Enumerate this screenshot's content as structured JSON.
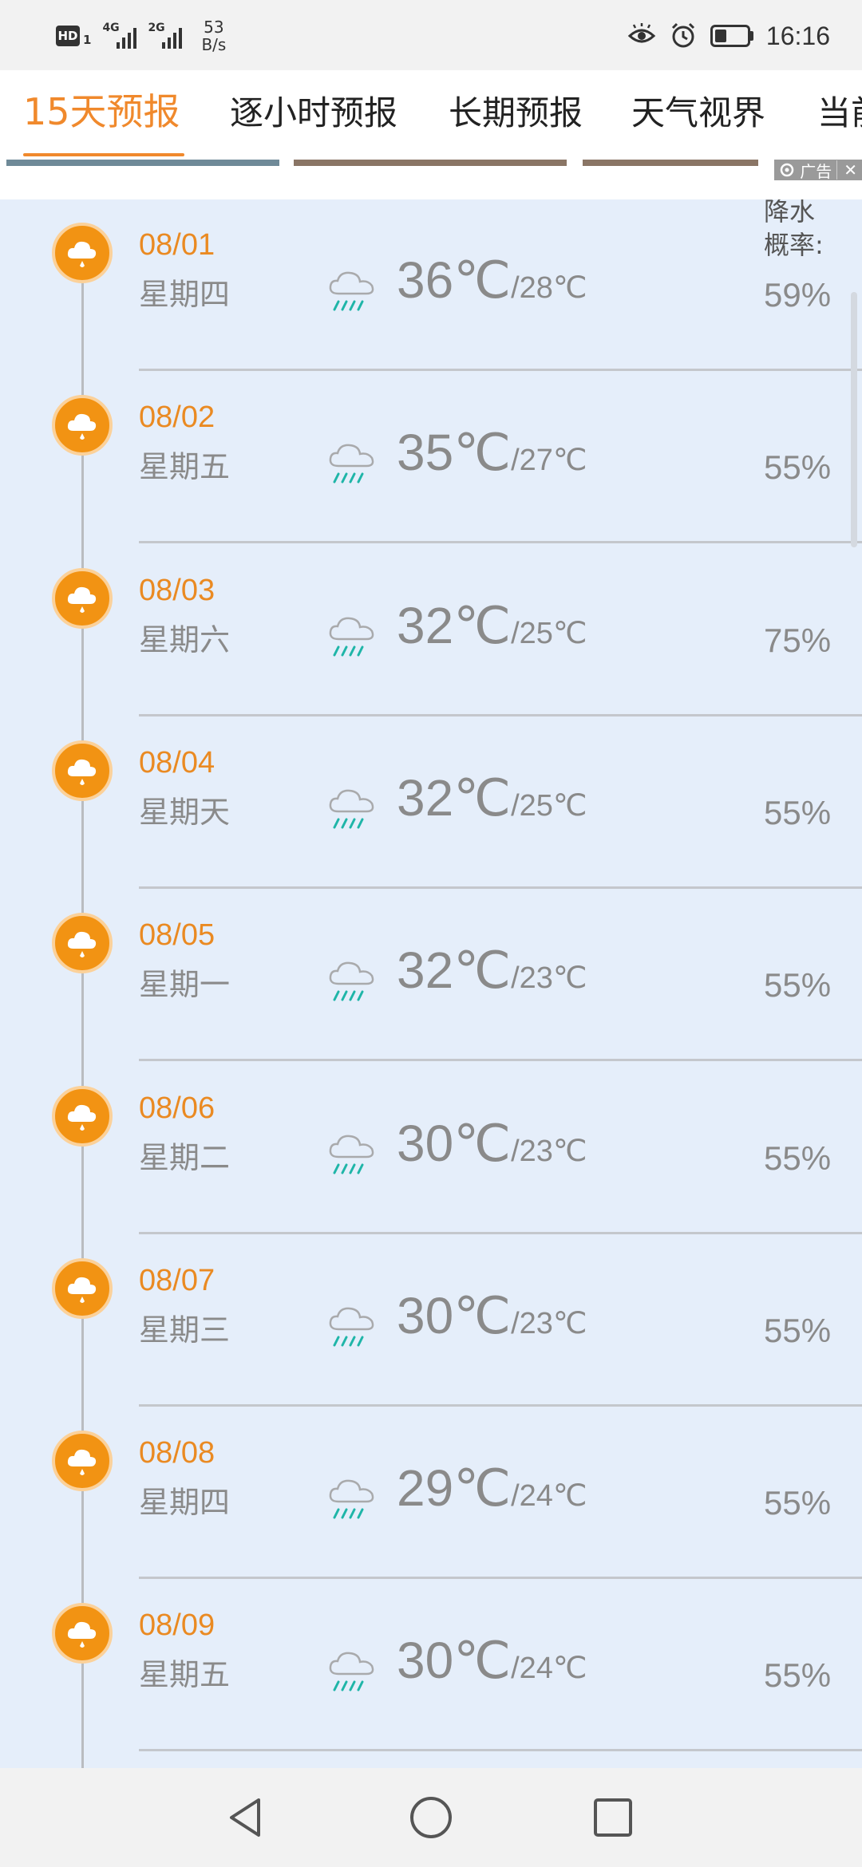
{
  "status_bar": {
    "hd": "HD",
    "sim1": "1",
    "net1": "4G",
    "net2": "2G",
    "speed_value": "53",
    "speed_unit": "B/s",
    "time": "16:16",
    "battery_level": 0.38
  },
  "tabs": [
    {
      "label": "15天预报",
      "active": true
    },
    {
      "label": "逐小时预报",
      "active": false
    },
    {
      "label": "长期预报",
      "active": false
    },
    {
      "label": "天气视界",
      "active": false
    },
    {
      "label": "当前",
      "active": false
    }
  ],
  "ad": {
    "label": "广告",
    "close": "✕"
  },
  "precip_header": {
    "line1": "降水",
    "line2": "概率:"
  },
  "forecast": [
    {
      "date": "08/01",
      "weekday": "星期四",
      "high": "36℃",
      "low": "/28℃",
      "precip": "59%",
      "icon": "rain-icon"
    },
    {
      "date": "08/02",
      "weekday": "星期五",
      "high": "35℃",
      "low": "/27℃",
      "precip": "55%",
      "icon": "rain-icon"
    },
    {
      "date": "08/03",
      "weekday": "星期六",
      "high": "32℃",
      "low": "/25℃",
      "precip": "75%",
      "icon": "rain-icon"
    },
    {
      "date": "08/04",
      "weekday": "星期天",
      "high": "32℃",
      "low": "/25℃",
      "precip": "55%",
      "icon": "rain-icon"
    },
    {
      "date": "08/05",
      "weekday": "星期一",
      "high": "32℃",
      "low": "/23℃",
      "precip": "55%",
      "icon": "rain-icon"
    },
    {
      "date": "08/06",
      "weekday": "星期二",
      "high": "30℃",
      "low": "/23℃",
      "precip": "55%",
      "icon": "rain-icon"
    },
    {
      "date": "08/07",
      "weekday": "星期三",
      "high": "30℃",
      "low": "/23℃",
      "precip": "55%",
      "icon": "rain-icon"
    },
    {
      "date": "08/08",
      "weekday": "星期四",
      "high": "29℃",
      "low": "/24℃",
      "precip": "55%",
      "icon": "rain-icon"
    },
    {
      "date": "08/09",
      "weekday": "星期五",
      "high": "30℃",
      "low": "/24℃",
      "precip": "55%",
      "icon": "rain-icon"
    }
  ],
  "colors": {
    "accent": "#f0892c",
    "timeline_dot": "#f29313",
    "list_bg": "#e5eefa",
    "rain_drops": "#1fb5a8"
  }
}
